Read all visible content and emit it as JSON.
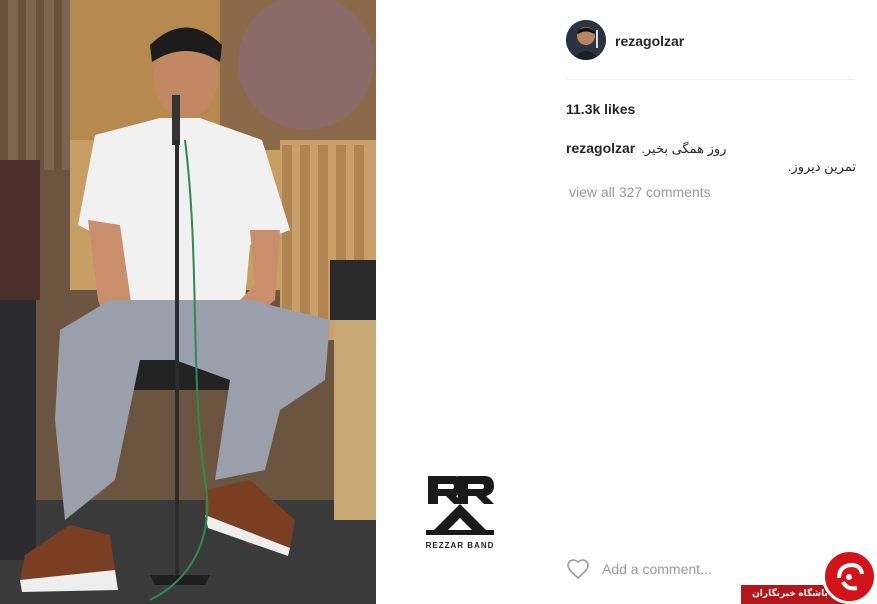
{
  "post": {
    "username": "rezagolzar",
    "likes": "11.3k likes",
    "caption_user": "rezagolzar",
    "caption_line1": "روز همگی بخیر.",
    "caption_line2": "تمرین دیروز.",
    "view_all": "view all 327 comments",
    "add_comment_placeholder": "Add a comment..."
  },
  "logo": {
    "text": "REZZAR BAND"
  },
  "watermark": {
    "text": "باشگاه خبرنگاران"
  }
}
